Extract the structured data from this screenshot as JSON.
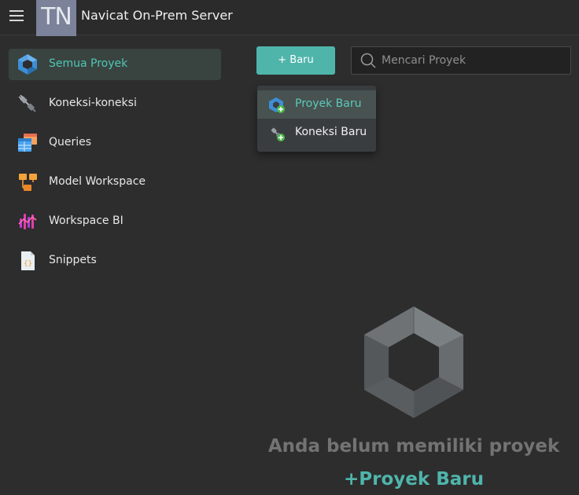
{
  "header": {
    "menu_icon": "hamburger-menu-icon",
    "avatar_initials": "TN",
    "title": "Navicat On-Prem Server"
  },
  "sidebar": {
    "items": [
      {
        "label": "Semua Proyek",
        "icon": "all-projects-icon",
        "active": true
      },
      {
        "label": "Koneksi-koneksi",
        "icon": "connection-plug-icon",
        "active": false
      },
      {
        "label": "Queries",
        "icon": "queries-table-icon",
        "active": false
      },
      {
        "label": "Model Workspace",
        "icon": "model-workspace-icon",
        "active": false
      },
      {
        "label": "Workspace BI",
        "icon": "bi-workspace-icon",
        "active": false
      },
      {
        "label": "Snippets",
        "icon": "snippets-file-icon",
        "active": false
      }
    ]
  },
  "toolbar": {
    "new_button_label": "+ Baru",
    "search_placeholder": "Mencari Proyek"
  },
  "new_menu": {
    "items": [
      {
        "label": "Proyek Baru",
        "icon": "new-project-icon",
        "highlighted": true
      },
      {
        "label": "Koneksi Baru",
        "icon": "new-connection-icon",
        "highlighted": false
      }
    ]
  },
  "empty_state": {
    "message": "Anda belum memiliki proyek",
    "action": "+Proyek Baru"
  },
  "colors": {
    "accent": "#4fb5ab",
    "background": "#2d2d2d",
    "active_item_bg": "#394440"
  }
}
